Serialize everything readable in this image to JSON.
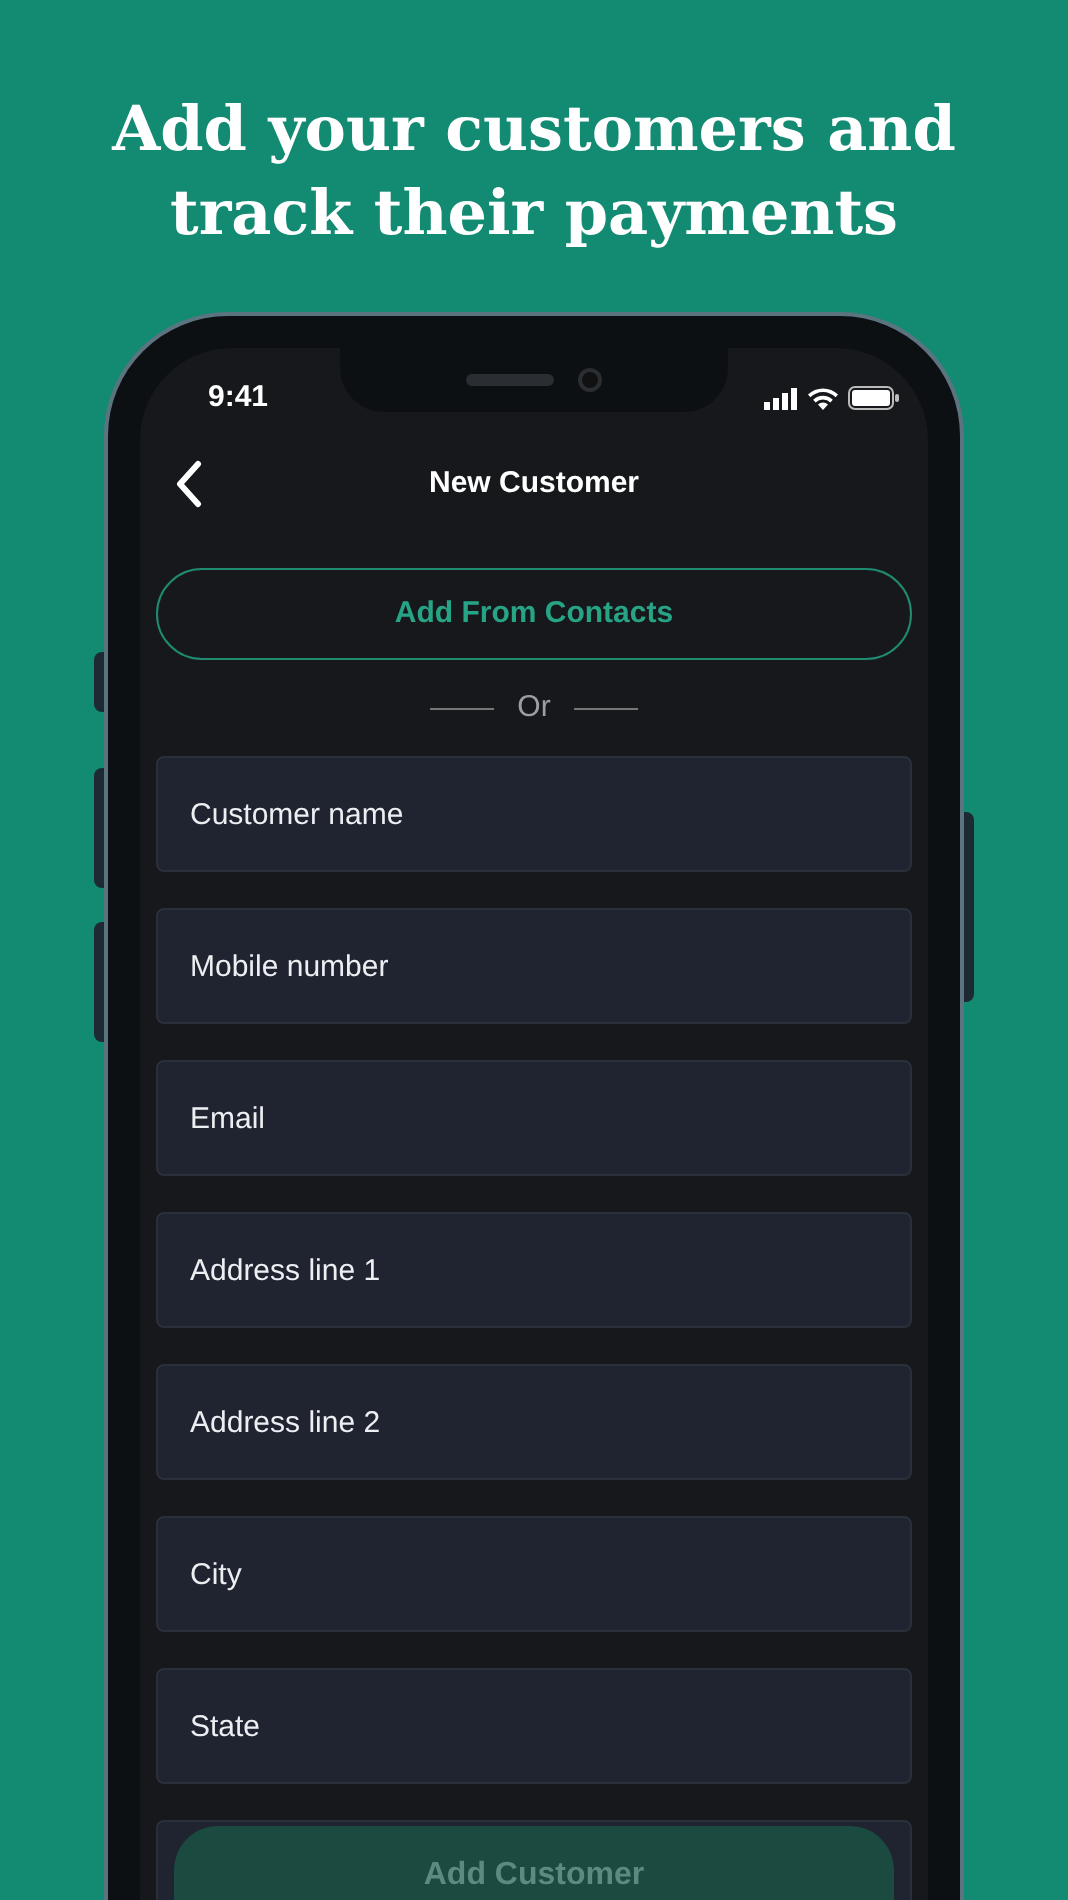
{
  "headline": [
    "Add your customers and",
    "track their payments"
  ],
  "status_bar": {
    "time": "9:41"
  },
  "header": {
    "title": "New Customer"
  },
  "contacts_button": {
    "label": "Add From Contacts"
  },
  "divider": {
    "label": "Or"
  },
  "fields": [
    {
      "placeholder": "Customer name"
    },
    {
      "placeholder": "Mobile number"
    },
    {
      "placeholder": "Email"
    },
    {
      "placeholder": "Address line 1"
    },
    {
      "placeholder": "Address line 2"
    },
    {
      "placeholder": "City"
    },
    {
      "placeholder": "State"
    }
  ],
  "submit_button": {
    "label": "Add Customer",
    "disabled": true
  }
}
